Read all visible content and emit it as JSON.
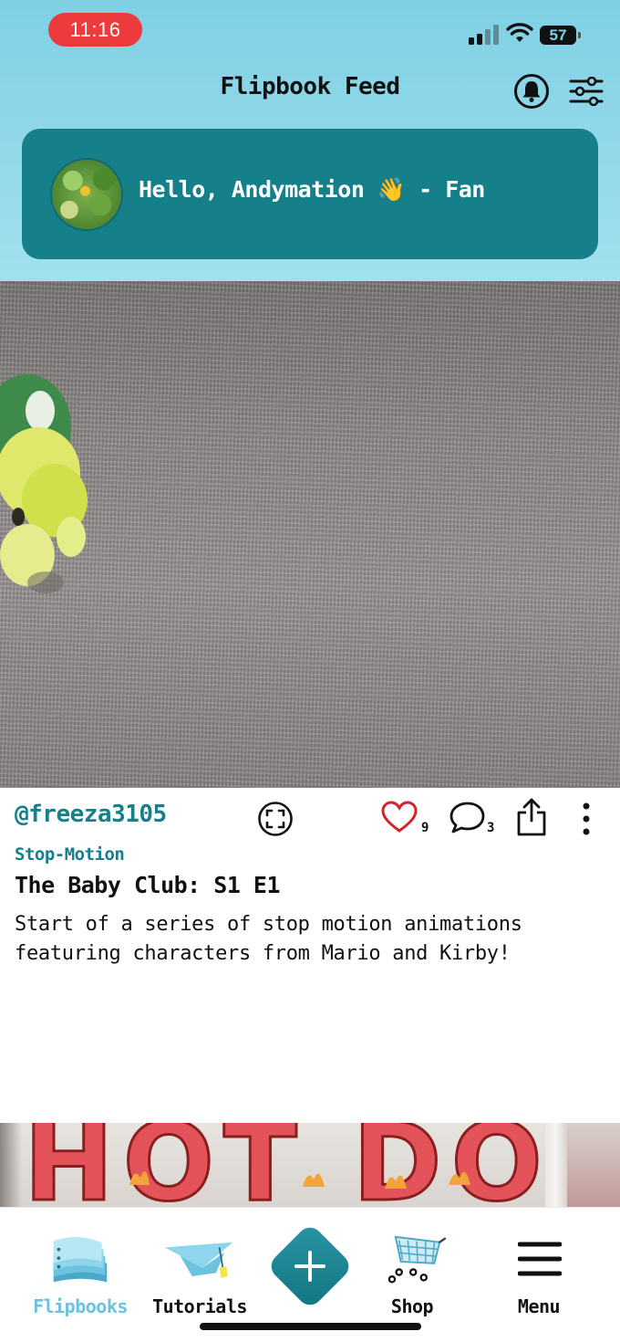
{
  "status_bar": {
    "time": "11:16",
    "battery": "57"
  },
  "header": {
    "title": "Flipbook Feed",
    "icons": [
      "bell-icon",
      "filter-sliders-icon"
    ]
  },
  "greeting": {
    "text": "Hello, Andymation 👋 - Fan"
  },
  "post": {
    "username": "@freeza3105",
    "likes": "9",
    "comments": "3",
    "category": "Stop-Motion",
    "title": "The Baby Club: S1 E1",
    "description": "Start of a series of stop motion animations featuring characters from Mario and Kirby!"
  },
  "next_post": {
    "preview_text": "HOT DOG"
  },
  "bottom_nav": {
    "items": [
      {
        "label": "Flipbooks",
        "icon": "flipbook-pages-icon",
        "active": true
      },
      {
        "label": "Tutorials",
        "icon": "graduation-cap-icon",
        "active": false
      },
      {
        "label": "",
        "icon": "plus-icon",
        "active": false
      },
      {
        "label": "Shop",
        "icon": "shopping-cart-icon",
        "active": false
      },
      {
        "label": "Menu",
        "icon": "hamburger-menu-icon",
        "active": false
      }
    ]
  },
  "colors": {
    "header_bg": "#7fd0e4",
    "accent_teal": "#16808a",
    "active_nav": "#6cc3df",
    "like_red": "#d8222b",
    "time_pill": "#ec3a3d"
  }
}
